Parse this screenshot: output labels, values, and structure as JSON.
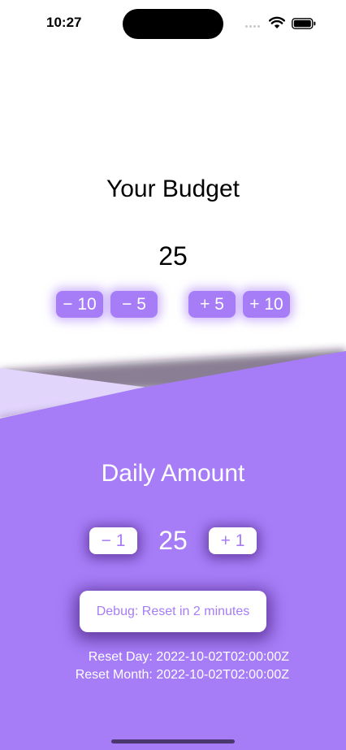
{
  "status_bar": {
    "time": "10:27"
  },
  "budget": {
    "title": "Your Budget",
    "value": "25",
    "buttons": {
      "minus10": "− 10",
      "minus5": "− 5",
      "plus5": "+ 5",
      "plus10": "+ 10"
    }
  },
  "daily": {
    "title": "Daily Amount",
    "value": "25",
    "minus1": "− 1",
    "plus1": "+ 1"
  },
  "debug": {
    "button_label": "Debug: Reset in 2 minutes",
    "reset_day": "Reset Day: 2022-10-02T02:00:00Z",
    "reset_month": "Reset Month: 2022-10-02T02:00:00Z"
  },
  "colors": {
    "accent": "#a67cf7",
    "accent_light": "#e2d5fc",
    "background": "#ffffff"
  }
}
